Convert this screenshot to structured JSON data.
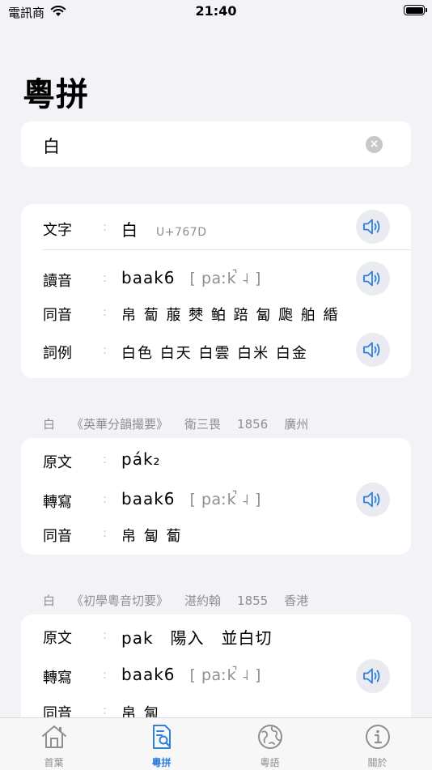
{
  "status": {
    "carrier": "電訊商",
    "time": "21:40"
  },
  "title": "粵拼",
  "search": {
    "value": "白"
  },
  "main_card": {
    "char_label": "文字",
    "char_value": "白",
    "char_code": "U+767D",
    "reading_label": "讀音",
    "reading_jyutping": "baak6",
    "reading_ipa": "[ paːk̚ ˨ ]",
    "homophone_label": "同音",
    "homophones": "帛 蔔 菔 僰 鲌 踣 匐 瓟 舶 緍",
    "examples_label": "詞例",
    "examples": "白色 白天 白雲 白米 白金"
  },
  "sources": [
    {
      "char": "白",
      "book": "《英華分韻撮要》",
      "author": "衛三畏",
      "year": "1856",
      "place": "廣州",
      "original_label": "原文",
      "original": "pák₂",
      "translit_label": "轉寫",
      "jyutping": "baak6",
      "ipa": "[ paːk̚ ˨ ]",
      "homophone_label": "同音",
      "homophones": "帛 匐 蔔"
    },
    {
      "char": "白",
      "book": "《初學粵音切要》",
      "author": "湛約翰",
      "year": "1855",
      "place": "香港",
      "original_label": "原文",
      "original": "pak　陽入　並白切",
      "translit_label": "轉寫",
      "jyutping": "baak6",
      "ipa": "[ paːk̚ ˨ ]",
      "homophone_label": "同音",
      "homophones": "帛 匐"
    }
  ],
  "tabs": [
    {
      "label": "首葉",
      "icon": "home-icon"
    },
    {
      "label": "粵拼",
      "icon": "search-document-icon",
      "active": true
    },
    {
      "label": "粵語",
      "icon": "globe-icon"
    },
    {
      "label": "關於",
      "icon": "info-icon"
    }
  ],
  "colors": {
    "accent": "#2f7fdc",
    "background": "#f2f2f7",
    "secondary_text": "#8e8e93"
  }
}
